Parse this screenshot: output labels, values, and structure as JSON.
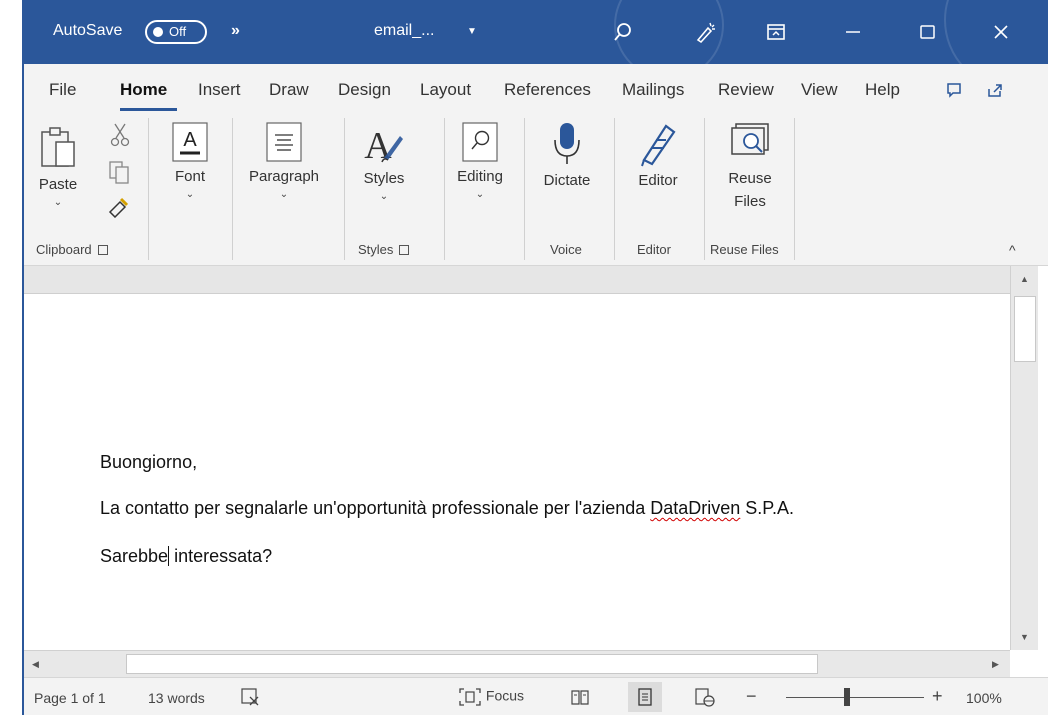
{
  "titlebar": {
    "autosave_label": "AutoSave",
    "autosave_state": "Off",
    "more": "»",
    "doc_title": "email_...",
    "colors": {
      "bar": "#2b579a"
    }
  },
  "tabs": [
    "File",
    "Home",
    "Insert",
    "Draw",
    "Design",
    "Layout",
    "References",
    "Mailings",
    "Review",
    "View",
    "Help"
  ],
  "ribbon": {
    "paste": "Paste",
    "font": "Font",
    "paragraph": "Paragraph",
    "styles": "Styles",
    "editing": "Editing",
    "dictate": "Dictate",
    "editor": "Editor",
    "reuse_files_line1": "Reuse",
    "reuse_files_line2": "Files",
    "groups": {
      "clipboard": "Clipboard",
      "styles": "Styles",
      "voice": "Voice",
      "editor": "Editor",
      "reuse_files": "Reuse Files"
    }
  },
  "document": {
    "greeting": "Buongiorno,",
    "line2_prefix": "La contatto per segnalarle un'opportunità professionale per l'azienda ",
    "line2_misspelled": "DataDriven",
    "line2_suffix": " S.P.A.",
    "line3_before_cursor": "Sarebbe",
    "line3_after_cursor": " interessata?"
  },
  "statusbar": {
    "page": "Page 1 of 1",
    "words": "13 words",
    "focus": "Focus",
    "zoom": "100%",
    "zoom_minus": "−",
    "zoom_plus": "+"
  }
}
